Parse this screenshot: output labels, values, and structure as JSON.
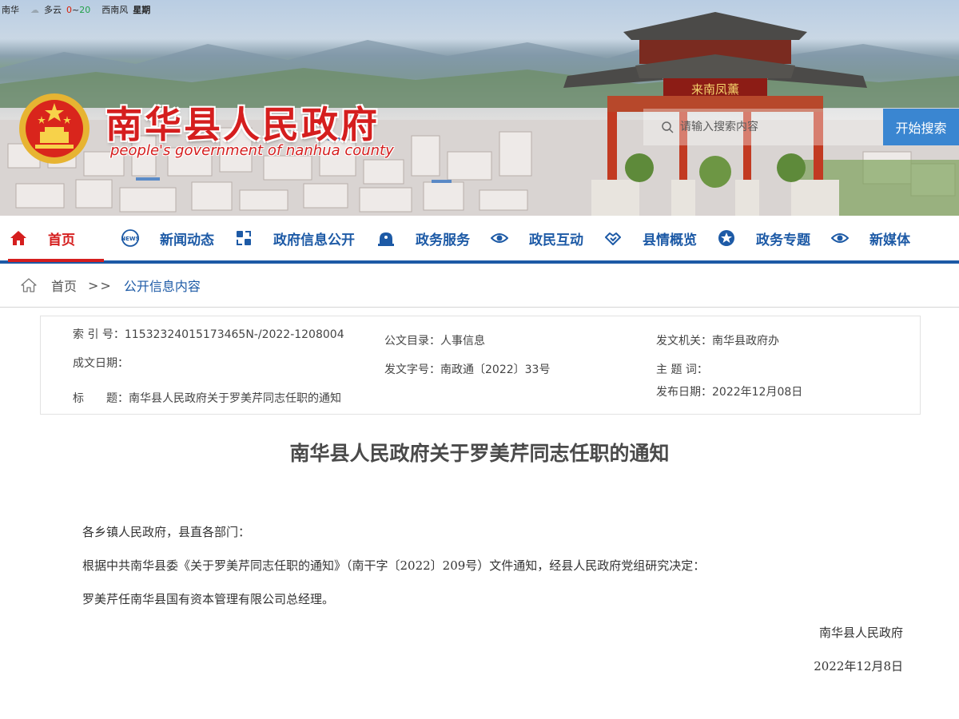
{
  "weather": {
    "city": "南华",
    "condition": "多云",
    "temp_low": "0",
    "temp_sep": "~",
    "temp_high": "20",
    "wind": "西南风",
    "weekday": "星期"
  },
  "header": {
    "title": "南华县人民政府",
    "subtitle": "people's government of nanhua county",
    "gate_plaque": "来南凤薰"
  },
  "search": {
    "placeholder": "请输入搜索内容",
    "button_label": "开始搜索"
  },
  "nav": {
    "items": [
      {
        "label": "首页",
        "icon": "home-icon"
      },
      {
        "label": "新闻动态",
        "icon": "news-icon"
      },
      {
        "label": "政府信息公开",
        "icon": "share-icon"
      },
      {
        "label": "政务服务",
        "icon": "service-icon"
      },
      {
        "label": "政民互动",
        "icon": "eye-icon"
      },
      {
        "label": "县情概览",
        "icon": "handshake-icon"
      },
      {
        "label": "政务专题",
        "icon": "star-icon"
      },
      {
        "label": "新媒体",
        "icon": "eye-icon"
      }
    ],
    "active_color": "#d51e1e",
    "color": "#1d5aa6"
  },
  "breadcrumb": {
    "home": "首页",
    "separator": ">>",
    "current": "公开信息内容"
  },
  "meta": {
    "index_no": "索 引 号：11532324015173465N-/2022-1208004",
    "catalog": "公文目录：人事信息",
    "issuer": "发文机关：南华县政府办",
    "created_date": "成文日期：",
    "doc_no": "发文字号：南政通〔2022〕33号",
    "keywords": "主 题 词：",
    "title": "标　　题：南华县人民政府关于罗美芹同志任职的通知",
    "publish_date": "发布日期：2022年12月08日"
  },
  "article": {
    "title": "南华县人民政府关于罗美芹同志任职的通知",
    "paragraphs": [
      "各乡镇人民政府，县直各部门：",
      "根据中共南华县委《关于罗美芹同志任职的通知》（南干字〔2022〕209号）文件通知，经县人民政府党组研究决定：",
      "罗美芹任南华县国有资本管理有限公司总经理。"
    ],
    "signature": "南华县人民政府",
    "date": "2022年12月8日"
  }
}
